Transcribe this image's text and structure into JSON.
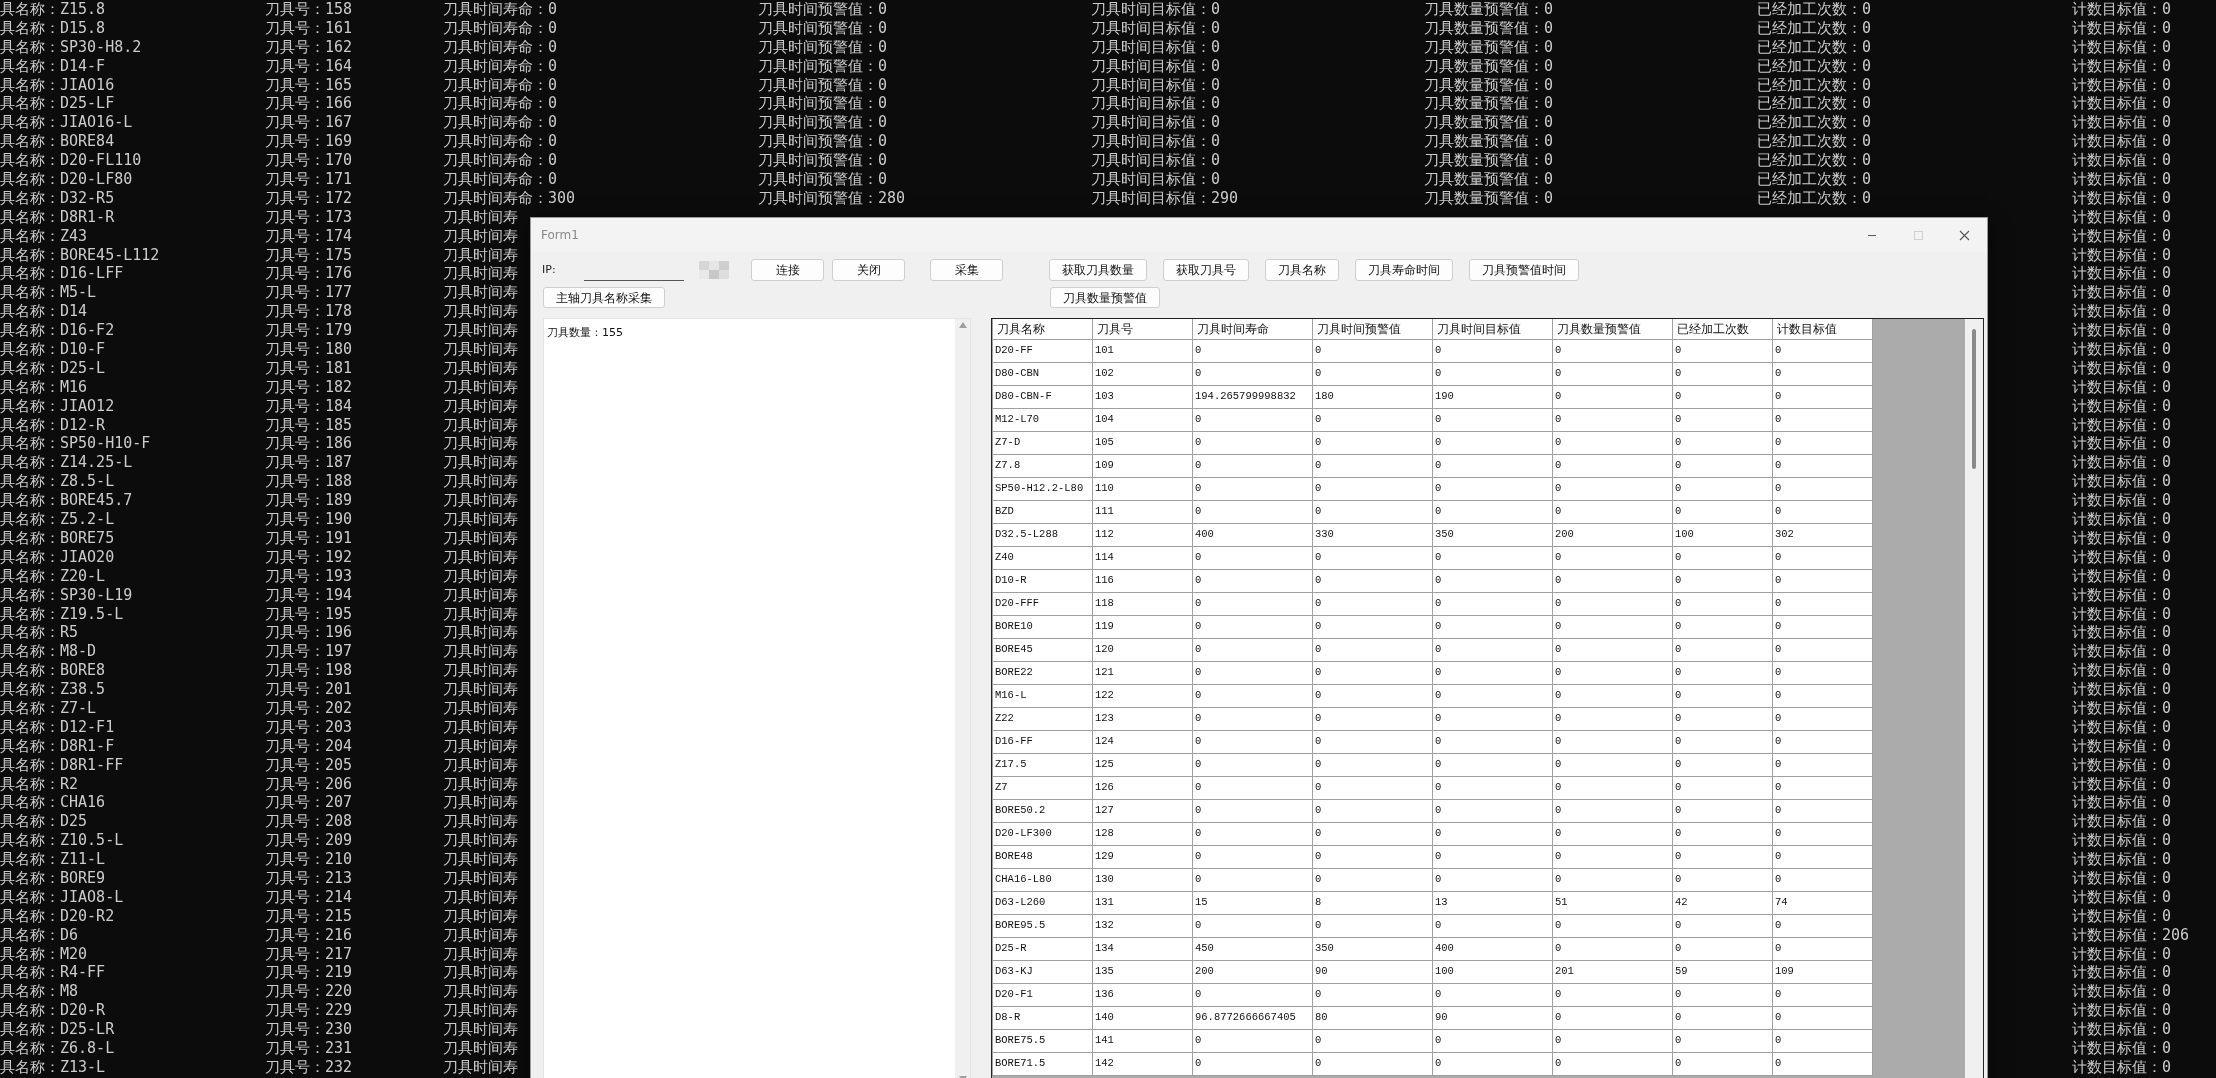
{
  "console": {
    "lines": [
      {
        "name": "具名称：Z15.8",
        "number": "刀具号：158",
        "life": "刀具时间寿命：0",
        "warn": "刀具时间预警值：0",
        "target": "刀具时间目标值：0",
        "count_warn": "刀具数量预警值：0",
        "done": "已经加工次数：0",
        "count_target": "计数目标值：0"
      },
      {
        "name": "具名称：D15.8",
        "number": "刀具号：161",
        "life": "刀具时间寿命：0",
        "warn": "刀具时间预警值：0",
        "target": "刀具时间目标值：0",
        "count_warn": "刀具数量预警值：0",
        "done": "已经加工次数：0",
        "count_target": "计数目标值：0"
      },
      {
        "name": "具名称：SP30-H8.2",
        "number": "刀具号：162",
        "life": "刀具时间寿命：0",
        "warn": "刀具时间预警值：0",
        "target": "刀具时间目标值：0",
        "count_warn": "刀具数量预警值：0",
        "done": "已经加工次数：0",
        "count_target": "计数目标值：0"
      },
      {
        "name": "具名称：D14-F",
        "number": "刀具号：164",
        "life": "刀具时间寿命：0",
        "warn": "刀具时间预警值：0",
        "target": "刀具时间目标值：0",
        "count_warn": "刀具数量预警值：0",
        "done": "已经加工次数：0",
        "count_target": "计数目标值：0"
      },
      {
        "name": "具名称：JIAO16",
        "number": "刀具号：165",
        "life": "刀具时间寿命：0",
        "warn": "刀具时间预警值：0",
        "target": "刀具时间目标值：0",
        "count_warn": "刀具数量预警值：0",
        "done": "已经加工次数：0",
        "count_target": "计数目标值：0"
      },
      {
        "name": "具名称：D25-LF",
        "number": "刀具号：166",
        "life": "刀具时间寿命：0",
        "warn": "刀具时间预警值：0",
        "target": "刀具时间目标值：0",
        "count_warn": "刀具数量预警值：0",
        "done": "已经加工次数：0",
        "count_target": "计数目标值：0"
      },
      {
        "name": "具名称：JIAO16-L",
        "number": "刀具号：167",
        "life": "刀具时间寿命：0",
        "warn": "刀具时间预警值：0",
        "target": "刀具时间目标值：0",
        "count_warn": "刀具数量预警值：0",
        "done": "已经加工次数：0",
        "count_target": "计数目标值：0"
      },
      {
        "name": "具名称：BORE84",
        "number": "刀具号：169",
        "life": "刀具时间寿命：0",
        "warn": "刀具时间预警值：0",
        "target": "刀具时间目标值：0",
        "count_warn": "刀具数量预警值：0",
        "done": "已经加工次数：0",
        "count_target": "计数目标值：0"
      },
      {
        "name": "具名称：D20-FL110",
        "number": "刀具号：170",
        "life": "刀具时间寿命：0",
        "warn": "刀具时间预警值：0",
        "target": "刀具时间目标值：0",
        "count_warn": "刀具数量预警值：0",
        "done": "已经加工次数：0",
        "count_target": "计数目标值：0"
      },
      {
        "name": "具名称：D20-LF80",
        "number": "刀具号：171",
        "life": "刀具时间寿命：0",
        "warn": "刀具时间预警值：0",
        "target": "刀具时间目标值：0",
        "count_warn": "刀具数量预警值：0",
        "done": "已经加工次数：0",
        "count_target": "计数目标值：0"
      },
      {
        "name": "具名称：D32-R5",
        "number": "刀具号：172",
        "life": "刀具时间寿命：300",
        "warn": "刀具时间预警值：280",
        "target": "刀具时间目标值：290",
        "count_warn": "刀具数量预警值：0",
        "done": "已经加工次数：0",
        "count_target": "计数目标值：0"
      },
      {
        "name": "具名称：D8R1-R",
        "number": "刀具号：173",
        "life": "刀具时间寿",
        "count_target": "计数目标值：0"
      },
      {
        "name": "具名称：Z43",
        "number": "刀具号：174",
        "life": "刀具时间寿",
        "count_target": "计数目标值：0"
      },
      {
        "name": "具名称：BORE45-L112",
        "number": "刀具号：175",
        "life": "刀具时间寿",
        "count_target": "计数目标值：0"
      },
      {
        "name": "具名称：D16-LFF",
        "number": "刀具号：176",
        "life": "刀具时间寿",
        "count_target": "计数目标值：0"
      },
      {
        "name": "具名称：M5-L",
        "number": "刀具号：177",
        "life": "刀具时间寿",
        "count_target": "计数目标值：0"
      },
      {
        "name": "具名称：D14",
        "number": "刀具号：178",
        "life": "刀具时间寿",
        "count_target": "计数目标值：0"
      },
      {
        "name": "具名称：D16-F2",
        "number": "刀具号：179",
        "life": "刀具时间寿",
        "count_target": "计数目标值：0"
      },
      {
        "name": "具名称：D10-F",
        "number": "刀具号：180",
        "life": "刀具时间寿",
        "count_target": "计数目标值：0"
      },
      {
        "name": "具名称：D25-L",
        "number": "刀具号：181",
        "life": "刀具时间寿",
        "count_target": "计数目标值：0"
      },
      {
        "name": "具名称：M16",
        "number": "刀具号：182",
        "life": "刀具时间寿",
        "count_target": "计数目标值：0"
      },
      {
        "name": "具名称：JIAO12",
        "number": "刀具号：184",
        "life": "刀具时间寿",
        "count_target": "计数目标值：0"
      },
      {
        "name": "具名称：D12-R",
        "number": "刀具号：185",
        "life": "刀具时间寿",
        "count_target": "计数目标值：0"
      },
      {
        "name": "具名称：SP50-H10-F",
        "number": "刀具号：186",
        "life": "刀具时间寿",
        "count_target": "计数目标值：0"
      },
      {
        "name": "具名称：Z14.25-L",
        "number": "刀具号：187",
        "life": "刀具时间寿",
        "count_target": "计数目标值：0"
      },
      {
        "name": "具名称：Z8.5-L",
        "number": "刀具号：188",
        "life": "刀具时间寿",
        "count_target": "计数目标值：0"
      },
      {
        "name": "具名称：BORE45.7",
        "number": "刀具号：189",
        "life": "刀具时间寿",
        "count_target": "计数目标值：0"
      },
      {
        "name": "具名称：Z5.2-L",
        "number": "刀具号：190",
        "life": "刀具时间寿",
        "count_target": "计数目标值：0"
      },
      {
        "name": "具名称：BORE75",
        "number": "刀具号：191",
        "life": "刀具时间寿",
        "count_target": "计数目标值：0"
      },
      {
        "name": "具名称：JIAO20",
        "number": "刀具号：192",
        "life": "刀具时间寿",
        "count_target": "计数目标值：0"
      },
      {
        "name": "具名称：Z20-L",
        "number": "刀具号：193",
        "life": "刀具时间寿",
        "count_target": "计数目标值：0"
      },
      {
        "name": "具名称：SP30-L19",
        "number": "刀具号：194",
        "life": "刀具时间寿",
        "count_target": "计数目标值：0"
      },
      {
        "name": "具名称：Z19.5-L",
        "number": "刀具号：195",
        "life": "刀具时间寿",
        "count_target": "计数目标值：0"
      },
      {
        "name": "具名称：R5",
        "number": "刀具号：196",
        "life": "刀具时间寿",
        "count_target": "计数目标值：0"
      },
      {
        "name": "具名称：M8-D",
        "number": "刀具号：197",
        "life": "刀具时间寿",
        "count_target": "计数目标值：0"
      },
      {
        "name": "具名称：BORE8",
        "number": "刀具号：198",
        "life": "刀具时间寿",
        "count_target": "计数目标值：0"
      },
      {
        "name": "具名称：Z38.5",
        "number": "刀具号：201",
        "life": "刀具时间寿",
        "count_target": "计数目标值：0"
      },
      {
        "name": "具名称：Z7-L",
        "number": "刀具号：202",
        "life": "刀具时间寿",
        "count_target": "计数目标值：0"
      },
      {
        "name": "具名称：D12-F1",
        "number": "刀具号：203",
        "life": "刀具时间寿",
        "count_target": "计数目标值：0"
      },
      {
        "name": "具名称：D8R1-F",
        "number": "刀具号：204",
        "life": "刀具时间寿",
        "count_target": "计数目标值：0"
      },
      {
        "name": "具名称：D8R1-FF",
        "number": "刀具号：205",
        "life": "刀具时间寿",
        "count_target": "计数目标值：0"
      },
      {
        "name": "具名称：R2",
        "number": "刀具号：206",
        "life": "刀具时间寿",
        "count_target": "计数目标值：0"
      },
      {
        "name": "具名称：CHA16",
        "number": "刀具号：207",
        "life": "刀具时间寿",
        "count_target": "计数目标值：0"
      },
      {
        "name": "具名称：D25",
        "number": "刀具号：208",
        "life": "刀具时间寿",
        "count_target": "计数目标值：0"
      },
      {
        "name": "具名称：Z10.5-L",
        "number": "刀具号：209",
        "life": "刀具时间寿",
        "count_target": "计数目标值：0"
      },
      {
        "name": "具名称：Z11-L",
        "number": "刀具号：210",
        "life": "刀具时间寿",
        "count_target": "计数目标值：0"
      },
      {
        "name": "具名称：BORE9",
        "number": "刀具号：213",
        "life": "刀具时间寿",
        "count_target": "计数目标值：0"
      },
      {
        "name": "具名称：JIAO8-L",
        "number": "刀具号：214",
        "life": "刀具时间寿",
        "count_target": "计数目标值：0"
      },
      {
        "name": "具名称：D20-R2",
        "number": "刀具号：215",
        "life": "刀具时间寿",
        "count_target": "计数目标值：0"
      },
      {
        "name": "具名称：D6",
        "number": "刀具号：216",
        "life": "刀具时间寿",
        "count_target": "计数目标值：206"
      },
      {
        "name": "具名称：M20",
        "number": "刀具号：217",
        "life": "刀具时间寿",
        "count_target": "计数目标值：0"
      },
      {
        "name": "具名称：R4-FF",
        "number": "刀具号：219",
        "life": "刀具时间寿",
        "count_target": "计数目标值：0"
      },
      {
        "name": "具名称：M8",
        "number": "刀具号：220",
        "life": "刀具时间寿",
        "count_target": "计数目标值：0"
      },
      {
        "name": "具名称：D20-R",
        "number": "刀具号：229",
        "life": "刀具时间寿",
        "count_target": "计数目标值：0"
      },
      {
        "name": "具名称：D25-LR",
        "number": "刀具号：230",
        "life": "刀具时间寿",
        "count_target": "计数目标值：0"
      },
      {
        "name": "具名称：Z6.8-L",
        "number": "刀具号：231",
        "life": "刀具时间寿",
        "count_target": "计数目标值：0"
      },
      {
        "name": "具名称：Z13-L",
        "number": "刀具号：232",
        "life": "刀具时间寿",
        "count_target": "计数目标值：0"
      }
    ]
  },
  "window": {
    "title": "Form1",
    "controls": [
      {
        "kind": "minimize",
        "disabled": false
      },
      {
        "kind": "maximize",
        "disabled": true
      },
      {
        "kind": "close",
        "disabled": false
      }
    ]
  },
  "toolbar": {
    "ip_label": "IP:",
    "left_buttons": [
      "连接",
      "关闭",
      "采集"
    ],
    "main_buttons": [
      "获取刀具数量",
      "获取刀具号",
      "刀具名称",
      "刀具寿命时间",
      "刀具预警值时间"
    ],
    "second_left_buttons": [
      "主轴刀具名称采集"
    ],
    "second_main_buttons": [
      "刀具数量预警值"
    ]
  },
  "log_box": {
    "text": "刀具数量：155"
  },
  "table": {
    "columns": [
      "刀具名称",
      "刀具号",
      "刀具时间寿命",
      "刀具时间预警值",
      "刀具时间目标值",
      "刀具数量预警值",
      "已经加工次数",
      "计数目标值"
    ],
    "rows": [
      [
        "D20-FF",
        "101",
        "0",
        "0",
        "0",
        "0",
        "0",
        "0"
      ],
      [
        "D80-CBN",
        "102",
        "0",
        "0",
        "0",
        "0",
        "0",
        "0"
      ],
      [
        "D80-CBN-F",
        "103",
        "194.265799998832",
        "180",
        "190",
        "0",
        "0",
        "0"
      ],
      [
        "M12-L70",
        "104",
        "0",
        "0",
        "0",
        "0",
        "0",
        "0"
      ],
      [
        "Z7-D",
        "105",
        "0",
        "0",
        "0",
        "0",
        "0",
        "0"
      ],
      [
        "Z7.8",
        "109",
        "0",
        "0",
        "0",
        "0",
        "0",
        "0"
      ],
      [
        "SP50-H12.2-L80",
        "110",
        "0",
        "0",
        "0",
        "0",
        "0",
        "0"
      ],
      [
        "BZD",
        "111",
        "0",
        "0",
        "0",
        "0",
        "0",
        "0"
      ],
      [
        "D32.5-L288",
        "112",
        "400",
        "330",
        "350",
        "200",
        "100",
        "302"
      ],
      [
        "Z40",
        "114",
        "0",
        "0",
        "0",
        "0",
        "0",
        "0"
      ],
      [
        "D10-R",
        "116",
        "0",
        "0",
        "0",
        "0",
        "0",
        "0"
      ],
      [
        "D20-FFF",
        "118",
        "0",
        "0",
        "0",
        "0",
        "0",
        "0"
      ],
      [
        "BORE10",
        "119",
        "0",
        "0",
        "0",
        "0",
        "0",
        "0"
      ],
      [
        "BORE45",
        "120",
        "0",
        "0",
        "0",
        "0",
        "0",
        "0"
      ],
      [
        "BORE22",
        "121",
        "0",
        "0",
        "0",
        "0",
        "0",
        "0"
      ],
      [
        "M16-L",
        "122",
        "0",
        "0",
        "0",
        "0",
        "0",
        "0"
      ],
      [
        "Z22",
        "123",
        "0",
        "0",
        "0",
        "0",
        "0",
        "0"
      ],
      [
        "D16-FF",
        "124",
        "0",
        "0",
        "0",
        "0",
        "0",
        "0"
      ],
      [
        "Z17.5",
        "125",
        "0",
        "0",
        "0",
        "0",
        "0",
        "0"
      ],
      [
        "Z7",
        "126",
        "0",
        "0",
        "0",
        "0",
        "0",
        "0"
      ],
      [
        "BORE50.2",
        "127",
        "0",
        "0",
        "0",
        "0",
        "0",
        "0"
      ],
      [
        "D20-LF300",
        "128",
        "0",
        "0",
        "0",
        "0",
        "0",
        "0"
      ],
      [
        "BORE48",
        "129",
        "0",
        "0",
        "0",
        "0",
        "0",
        "0"
      ],
      [
        "CHA16-L80",
        "130",
        "0",
        "0",
        "0",
        "0",
        "0",
        "0"
      ],
      [
        "D63-L260",
        "131",
        "15",
        "8",
        "13",
        "51",
        "42",
        "74"
      ],
      [
        "BORE95.5",
        "132",
        "0",
        "0",
        "0",
        "0",
        "0",
        "0"
      ],
      [
        "D25-R",
        "134",
        "450",
        "350",
        "400",
        "0",
        "0",
        "0"
      ],
      [
        "D63-KJ",
        "135",
        "200",
        "90",
        "100",
        "201",
        "59",
        "109"
      ],
      [
        "D20-F1",
        "136",
        "0",
        "0",
        "0",
        "0",
        "0",
        "0"
      ],
      [
        "D8-R",
        "140",
        "96.8772666667405",
        "80",
        "90",
        "0",
        "0",
        "0"
      ],
      [
        "BORE75.5",
        "141",
        "0",
        "0",
        "0",
        "0",
        "0",
        "0"
      ],
      [
        "BORE71.5",
        "142",
        "0",
        "0",
        "0",
        "0",
        "0",
        "0"
      ]
    ]
  }
}
